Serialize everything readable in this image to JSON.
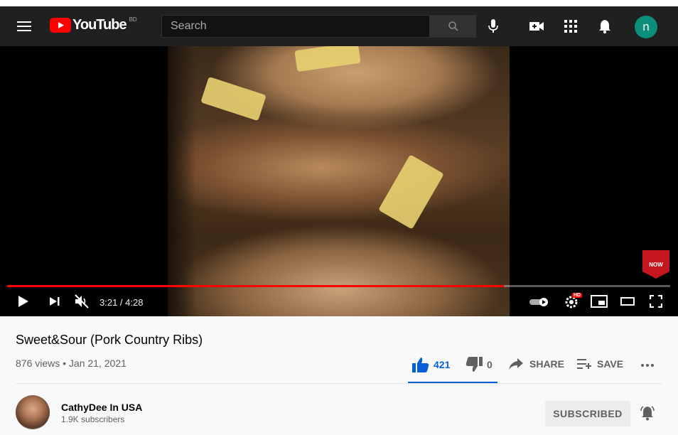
{
  "masthead": {
    "logo_text": "YouTube",
    "country_code": "BD",
    "search_placeholder": "Search",
    "avatar_letter": "n",
    "icons": [
      "menu-icon",
      "youtube-logo-icon",
      "search-icon",
      "microphone-icon",
      "create-video-icon",
      "apps-icon",
      "notifications-icon"
    ]
  },
  "player": {
    "current_time": "3:21",
    "duration": "4:28",
    "time_display": "3:21 / 4:28",
    "progress_fraction": 0.749,
    "badge_text": "NOW",
    "quality_badge": "HD",
    "icons": [
      "play-icon",
      "next-icon",
      "mute-icon",
      "autoplay-toggle-icon",
      "settings-icon",
      "miniplayer-icon",
      "theater-icon",
      "fullscreen-icon"
    ]
  },
  "video": {
    "title": "Sweet&Sour (Pork Country Ribs)",
    "views": "876 views",
    "date": "Jan 21, 2021",
    "meta_line": "876 views • Jan 21, 2021",
    "likes": "421",
    "dislikes": "0",
    "share_label": "SHARE",
    "save_label": "SAVE"
  },
  "channel": {
    "name": "CathyDee In USA",
    "subscribers": "1.9K subscribers",
    "subscribed_label": "SUBSCRIBED"
  },
  "colors": {
    "masthead_bg": "#202020",
    "brand_red": "#ff0000",
    "like_blue": "#065fd4",
    "avatar_teal": "#0b8f7a"
  }
}
